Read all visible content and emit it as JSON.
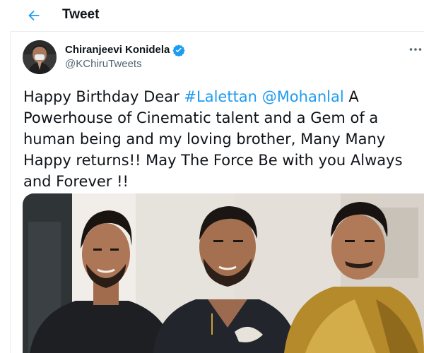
{
  "header": {
    "title": "Tweet",
    "back_icon": "arrow-left-icon",
    "accent": "#1d9bf0"
  },
  "author": {
    "name": "Chiranjeevi Konidela",
    "handle": "@KChiruTweets",
    "verified_icon": "verified-badge-icon",
    "avatar_icon": "avatar"
  },
  "more_icon": "more-dots-icon",
  "tweet": {
    "text_1": "Happy Birthday Dear ",
    "hashtag": "#Lalettan",
    "text_2": " ",
    "mention": "@Mohanlal",
    "text_3": " A Powerhouse of Cinematic talent and a Gem of a human being and my loving brother, Many Many Happy returns!! May The Force Be with you Always and Forever !!"
  },
  "media": {
    "icon": "photo"
  },
  "colors": {
    "text": "#0f1419",
    "secondary": "#536471",
    "link": "#1d9bf0",
    "divider": "#ebeef0"
  }
}
